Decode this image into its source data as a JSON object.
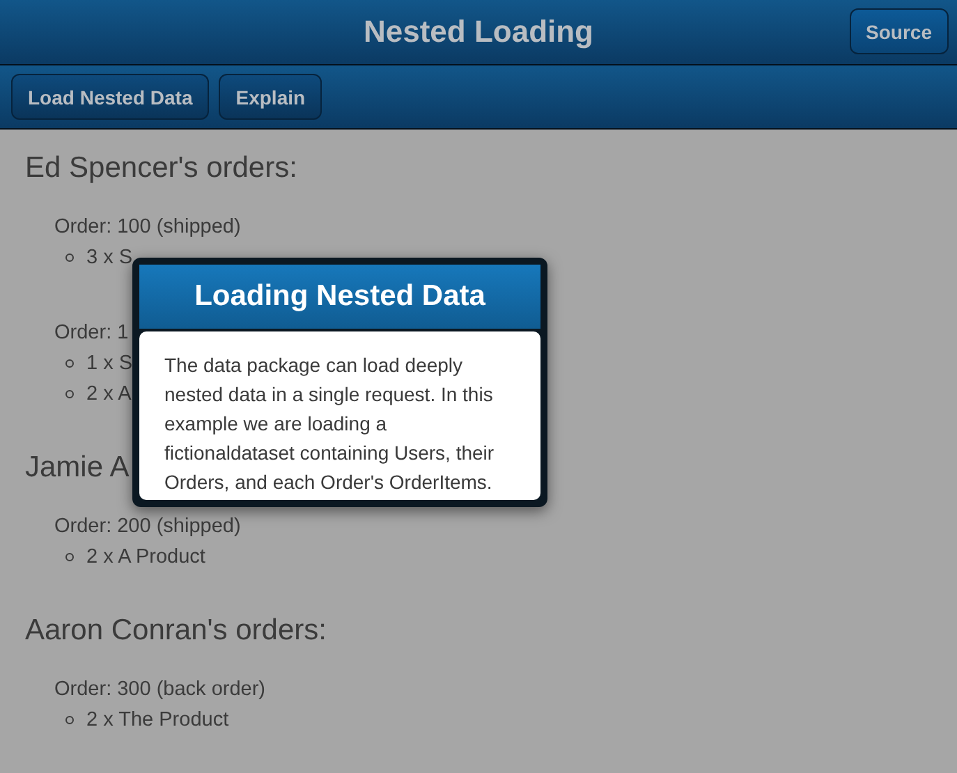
{
  "title_bar": {
    "title": "Nested Loading",
    "source_button": "Source"
  },
  "toolbar": {
    "buttons": [
      "Load Nested Data",
      "Explain"
    ]
  },
  "users": [
    {
      "heading": "Ed Spencer's orders:",
      "orders": [
        {
          "label": "Order: 100 (shipped)",
          "items": [
            "3 x S"
          ]
        },
        {
          "label": "Order: 1",
          "items": [
            "1 x S",
            "2 x A"
          ]
        }
      ]
    },
    {
      "heading": "Jamie A",
      "orders": [
        {
          "label": "Order: 200 (shipped)",
          "items": [
            "2 x A Product"
          ]
        }
      ]
    },
    {
      "heading": "Aaron Conran's orders:",
      "orders": [
        {
          "label": "Order: 300 (back order)",
          "items": [
            "2 x The Product"
          ]
        }
      ]
    }
  ],
  "modal": {
    "title": "Loading Nested Data",
    "body": "The data package can load deeply nested data in a single request. In this example we are loading a fictionaldataset containing Users, their Orders, and each Order's OrderItems."
  }
}
